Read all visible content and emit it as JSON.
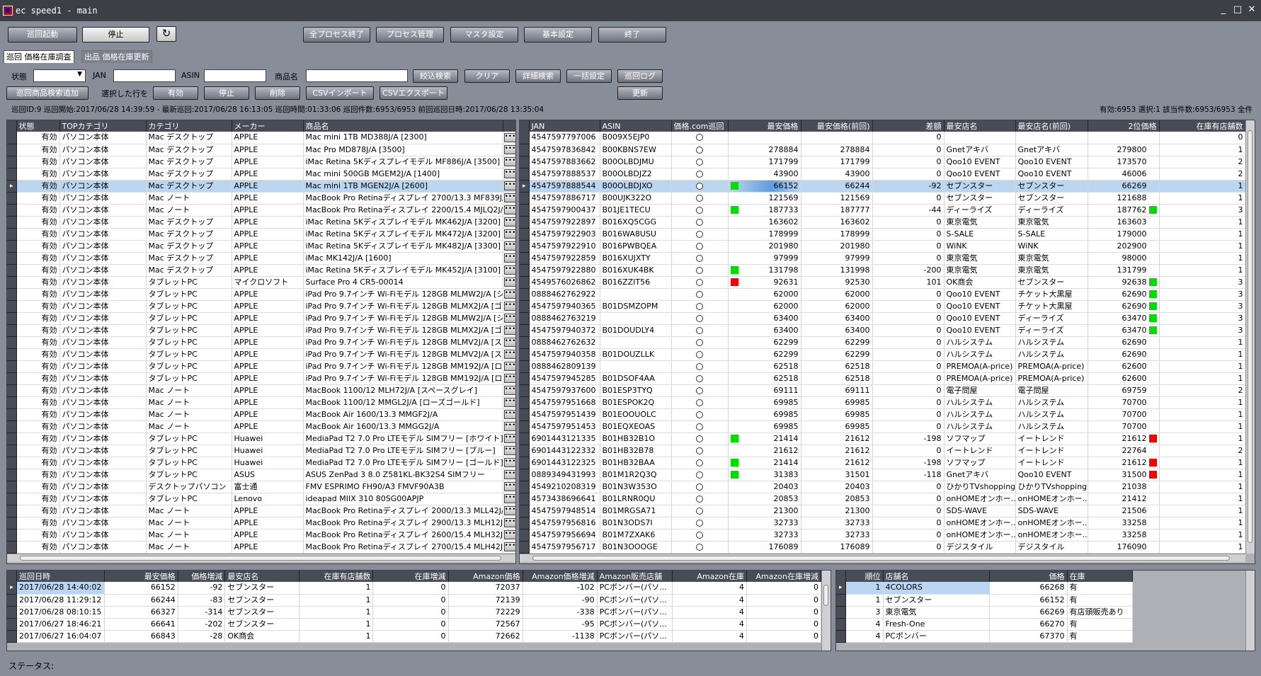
{
  "window": {
    "title": "ec speed1 - main",
    "min": "_",
    "max": "□",
    "close": "✕"
  },
  "toolbar": {
    "start": "巡回起動",
    "stop": "停止",
    "refresh": "↻",
    "all_stop": "全プロセス終了",
    "process": "プロセス管理",
    "master": "マスタ設定",
    "basic": "基本設定",
    "exit": "終了"
  },
  "tabs": [
    {
      "label": "巡回 価格在庫調査"
    },
    {
      "label": "出品 価格在庫更新"
    }
  ],
  "filter": {
    "state_label": "状態",
    "state_value": "",
    "jan_label": "JAN",
    "asin_label": "ASIN",
    "product_label": "商品名",
    "narrow": "絞込検索",
    "clear": "クリア",
    "detail": "詳細検索",
    "bulk": "一括設定",
    "log": "巡回ログ",
    "add": "巡回商品検索追加",
    "selected_rows": "選択した行を",
    "valid": "有効",
    "stop": "停止",
    "delete": "削除",
    "csv_import": "CSVインポート",
    "csv_export": "CSVエクスポート",
    "update": "更新"
  },
  "info": {
    "left": "巡回ID:9 巡回開始:2017/06/28 14:39:59 - 最新巡回:2017/06/28 16:13:05 巡回時間:01:33:06 巡回件数:6953/6953 前回巡回日時:2017/06/28 13:35:04",
    "right": "有効:6953 選択:1 該当件数:6953/6953 全件"
  },
  "left_table": {
    "headers": [
      "状態",
      "TOPカテゴリ",
      "カテゴリ",
      "メーカー",
      "商品名"
    ],
    "rows": [
      [
        "有効",
        "パソコン本体",
        "Mac デスクトップ",
        "APPLE",
        "Mac mini 1TB MD388J/A [2300]"
      ],
      [
        "有効",
        "パソコン本体",
        "Mac デスクトップ",
        "APPLE",
        "Mac Pro MD878J/A [3500]"
      ],
      [
        "有効",
        "パソコン本体",
        "Mac デスクトップ",
        "APPLE",
        "iMac Retina 5Kディスプレイモデル MF886J/A [3500]"
      ],
      [
        "有効",
        "パソコン本体",
        "Mac デスクトップ",
        "APPLE",
        "Mac mini 500GB MGEM2J/A [1400]"
      ],
      [
        "有効",
        "パソコン本体",
        "Mac デスクトップ",
        "APPLE",
        "Mac mini 1TB MGEN2J/A [2600]"
      ],
      [
        "有効",
        "パソコン本体",
        "Mac ノート",
        "APPLE",
        "MacBook Pro Retinaディスプレイ 2700/13.3 MF839J/A"
      ],
      [
        "有効",
        "パソコン本体",
        "Mac ノート",
        "APPLE",
        "MacBook Pro Retinaディスプレイ 2200/15.4 MJLQ2J/A"
      ],
      [
        "有効",
        "パソコン本体",
        "Mac デスクトップ",
        "APPLE",
        "iMac Retina 5Kディスプレイモデル MK462J/A [3200]"
      ],
      [
        "有効",
        "パソコン本体",
        "Mac デスクトップ",
        "APPLE",
        "iMac Retina 5Kディスプレイモデル MK472J/A [3200]"
      ],
      [
        "有効",
        "パソコン本体",
        "Mac デスクトップ",
        "APPLE",
        "iMac Retina 5Kディスプレイモデル MK482J/A [3300]"
      ],
      [
        "有効",
        "パソコン本体",
        "Mac デスクトップ",
        "APPLE",
        "iMac MK142J/A [1600]"
      ],
      [
        "有効",
        "パソコン本体",
        "Mac デスクトップ",
        "APPLE",
        "iMac Retina 5Kディスプレイモデル MK452J/A [3100]"
      ],
      [
        "有効",
        "パソコン本体",
        "タブレットPC",
        "マイクロソフト",
        "Surface Pro 4 CR5-00014"
      ],
      [
        "有効",
        "パソコン本体",
        "タブレットPC",
        "APPLE",
        "iPad Pro 9.7インチ Wi-Fiモデル 128GB MLMW2J/A [シ"
      ],
      [
        "有効",
        "パソコン本体",
        "タブレットPC",
        "APPLE",
        "iPad Pro 9.7インチ Wi-Fiモデル 128GB MLMX2J/A [ゴ"
      ],
      [
        "有効",
        "パソコン本体",
        "タブレットPC",
        "APPLE",
        "iPad Pro 9.7インチ Wi-Fiモデル 128GB MLMW2J/A [シ"
      ],
      [
        "有効",
        "パソコン本体",
        "タブレットPC",
        "APPLE",
        "iPad Pro 9.7インチ Wi-Fiモデル 128GB MLMX2J/A [ゴ"
      ],
      [
        "有効",
        "パソコン本体",
        "タブレットPC",
        "APPLE",
        "iPad Pro 9.7インチ Wi-Fiモデル 128GB MLMV2J/A [ス"
      ],
      [
        "有効",
        "パソコン本体",
        "タブレットPC",
        "APPLE",
        "iPad Pro 9.7インチ Wi-Fiモデル 128GB MLMV2J/A [ス"
      ],
      [
        "有効",
        "パソコン本体",
        "タブレットPC",
        "APPLE",
        "iPad Pro 9.7インチ Wi-Fiモデル 128GB MM192J/A [ロ"
      ],
      [
        "有効",
        "パソコン本体",
        "タブレットPC",
        "APPLE",
        "iPad Pro 9.7インチ Wi-Fiモデル 128GB MM192J/A [ロ"
      ],
      [
        "有効",
        "パソコン本体",
        "Mac ノート",
        "APPLE",
        "MacBook 1100/12 MLH72J/A [スペースグレイ]"
      ],
      [
        "有効",
        "パソコン本体",
        "Mac ノート",
        "APPLE",
        "MacBook 1100/12 MMGL2J/A [ローズゴールド]"
      ],
      [
        "有効",
        "パソコン本体",
        "Mac ノート",
        "APPLE",
        "MacBook Air 1600/13.3 MMGF2J/A"
      ],
      [
        "有効",
        "パソコン本体",
        "Mac ノート",
        "APPLE",
        "MacBook Air 1600/13.3 MMGG2J/A"
      ],
      [
        "有効",
        "パソコン本体",
        "タブレットPC",
        "Huawei",
        "MediaPad T2 7.0 Pro LTEモデル SIMフリー [ホワイト]"
      ],
      [
        "有効",
        "パソコン本体",
        "タブレットPC",
        "Huawei",
        "MediaPad T2 7.0 Pro LTEモデル SIMフリー [ブルー]"
      ],
      [
        "有効",
        "パソコン本体",
        "タブレットPC",
        "Huawei",
        "MediaPad T2 7.0 Pro LTEモデル SIMフリー [ゴールド]"
      ],
      [
        "有効",
        "パソコン本体",
        "タブレットPC",
        "ASUS",
        "ASUS ZenPad 3 8.0 Z581KL-BK32S4 SIMフリー"
      ],
      [
        "有効",
        "パソコン本体",
        "デスクトップパソコン",
        "富士通",
        "FMV ESPRIMO FH90/A3 FMVF90A3B"
      ],
      [
        "有効",
        "パソコン本体",
        "タブレットPC",
        "Lenovo",
        "ideapad MIIX 310 80SG00APJP"
      ],
      [
        "有効",
        "パソコン本体",
        "Mac ノート",
        "APPLE",
        "MacBook Pro Retinaディスプレイ 2000/13.3 MLL42J/A"
      ],
      [
        "有効",
        "パソコン本体",
        "Mac ノート",
        "APPLE",
        "MacBook Pro Retinaディスプレイ 2900/13.3 MLH12J/A"
      ],
      [
        "有効",
        "パソコン本体",
        "Mac ノート",
        "APPLE",
        "MacBook Pro Retinaディスプレイ 2600/15.4 MLH32J/A"
      ],
      [
        "有効",
        "パソコン本体",
        "Mac ノート",
        "APPLE",
        "MacBook Pro Retinaディスプレイ 2700/15.4 MLH42J/A"
      ]
    ]
  },
  "right_table": {
    "headers": [
      "JAN",
      "ASIN",
      "価格.com巡回",
      "最安価格",
      "最安価格(前回)",
      "差額",
      "最安店名",
      "最安店名(前回)",
      "2位価格",
      "在庫有店舗数"
    ],
    "rows": [
      [
        "4547597797006",
        "B009X5EJP0",
        "",
        "",
        "",
        "0",
        "",
        "",
        "",
        "",
        "0"
      ],
      [
        "4547597836842",
        "B00KBNS7EW",
        "",
        "278884",
        "278884",
        "0",
        "Gnetアキバ",
        "Gnetアキバ",
        "279800",
        "",
        "1"
      ],
      [
        "4547597883662",
        "B00OLBDJMU",
        "",
        "171799",
        "171799",
        "0",
        "Qoo10 EVENT",
        "Qoo10 EVENT",
        "173570",
        "",
        "2"
      ],
      [
        "4547597888537",
        "B00OLBDJZ2",
        "",
        "43900",
        "43900",
        "0",
        "Qoo10 EVENT",
        "Qoo10 EVENT",
        "46006",
        "",
        "2"
      ],
      [
        "4547597888544",
        "B00OLBDJXO",
        "green",
        "66152",
        "66244",
        "-92",
        "セブンスター",
        "セブンスター",
        "66269",
        "",
        "1"
      ],
      [
        "4547597886717",
        "B00UJK322O",
        "",
        "121569",
        "121569",
        "0",
        "セブンスター",
        "セブンスター",
        "121688",
        "",
        "1"
      ],
      [
        "4547597900437",
        "B01JE1TECU",
        "green",
        "187733",
        "187777",
        "-44",
        "ディーライズ",
        "ディーライズ",
        "187762",
        "green",
        "3"
      ],
      [
        "4547597922897",
        "B016XQ5CGG",
        "",
        "163602",
        "163602",
        "0",
        "東京電気",
        "東京電気",
        "163603",
        "",
        "1"
      ],
      [
        "4547597922903",
        "B016WA8USU",
        "",
        "178999",
        "178999",
        "0",
        "S-SALE",
        "S-SALE",
        "179000",
        "",
        "1"
      ],
      [
        "4547597922910",
        "B016PWBQEA",
        "",
        "201980",
        "201980",
        "0",
        "WiNK",
        "WiNK",
        "202900",
        "",
        "1"
      ],
      [
        "4547597922859",
        "B016XUJXTY",
        "",
        "97999",
        "97999",
        "0",
        "東京電気",
        "東京電気",
        "98000",
        "",
        "1"
      ],
      [
        "4547597922880",
        "B016XUK4BK",
        "green",
        "131798",
        "131998",
        "-200",
        "東京電気",
        "東京電気",
        "131799",
        "",
        "1"
      ],
      [
        "4549576026862",
        "B016ZZIT56",
        "red",
        "92631",
        "92530",
        "101",
        "OK商会",
        "セブンスター",
        "92638",
        "green",
        "3"
      ],
      [
        "0888462762922",
        "",
        "",
        "62000",
        "62000",
        "0",
        "Qoo10 EVENT",
        "チケット大黒屋",
        "62690",
        "green",
        "3"
      ],
      [
        "4547597940365",
        "B01DSMZOPM",
        "",
        "62000",
        "62000",
        "0",
        "Qoo10 EVENT",
        "チケット大黒屋",
        "62690",
        "green",
        "3"
      ],
      [
        "0888462763219",
        "",
        "",
        "63400",
        "63400",
        "0",
        "Qoo10 EVENT",
        "ディーライズ",
        "63470",
        "green",
        "3"
      ],
      [
        "4547597940372",
        "B01DOUDLY4",
        "",
        "63400",
        "63400",
        "0",
        "Qoo10 EVENT",
        "ディーライズ",
        "63470",
        "green",
        "3"
      ],
      [
        "0888462762632",
        "",
        "",
        "62299",
        "62299",
        "0",
        "ハルシステム",
        "ハルシステム",
        "62690",
        "",
        "1"
      ],
      [
        "4547597940358",
        "B01DOUZLLK",
        "",
        "62299",
        "62299",
        "0",
        "ハルシステム",
        "ハルシステム",
        "62690",
        "",
        "1"
      ],
      [
        "0888462809139",
        "",
        "",
        "62518",
        "62518",
        "0",
        "PREMOA(A-price)",
        "PREMOA(A-price)",
        "62600",
        "",
        "1"
      ],
      [
        "4547597945285",
        "B01DSOF4AA",
        "",
        "62518",
        "62518",
        "0",
        "PREMOA(A-price)",
        "PREMOA(A-price)",
        "62600",
        "",
        "1"
      ],
      [
        "4547597937600",
        "B01ESP3TYQ",
        "",
        "69111",
        "69111",
        "0",
        "電子問屋",
        "電子問屋",
        "69759",
        "",
        "2"
      ],
      [
        "4547597951668",
        "B01ESPOK2Q",
        "",
        "69985",
        "69985",
        "0",
        "ハルシステム",
        "ハルシステム",
        "70700",
        "",
        "1"
      ],
      [
        "4547597951439",
        "B01EOOUOLC",
        "",
        "69985",
        "69985",
        "0",
        "ハルシステム",
        "ハルシステム",
        "70700",
        "",
        "1"
      ],
      [
        "4547597951453",
        "B01EQXEOAS",
        "",
        "69985",
        "69985",
        "0",
        "ハルシステム",
        "ハルシステム",
        "70700",
        "",
        "1"
      ],
      [
        "6901443121335",
        "B01HB32B1O",
        "green",
        "21414",
        "21612",
        "-198",
        "ソフマップ",
        "イートレンド",
        "21612",
        "red",
        "1"
      ],
      [
        "6901443122332",
        "B01HB32B78",
        "",
        "21612",
        "21612",
        "0",
        "イートレンド",
        "イートレンド",
        "22764",
        "",
        "2"
      ],
      [
        "6901443122325",
        "B01HB32BAA",
        "green",
        "21414",
        "21612",
        "-198",
        "ソフマップ",
        "イートレンド",
        "21612",
        "red",
        "1"
      ],
      [
        "0889349431993",
        "B01M1R2Q3Q",
        "green",
        "31383",
        "31501",
        "-118",
        "Gnetアキバ",
        "Qoo10 EVENT",
        "31500",
        "red",
        "1"
      ],
      [
        "4549210208319",
        "B01N3W353O",
        "",
        "20403",
        "20403",
        "0",
        "ひかりTVshopping",
        "ひかりTVshopping",
        "21038",
        "",
        "1"
      ],
      [
        "4573438696641",
        "B01LRNR0QU",
        "",
        "20853",
        "20853",
        "0",
        "onHOMEオンホー...",
        "onHOMEオンホー...",
        "21412",
        "",
        "1"
      ],
      [
        "4547597948514",
        "B01MRGSA71",
        "",
        "21300",
        "21300",
        "0",
        "SDS-WAVE",
        "SDS-WAVE",
        "21506",
        "",
        "1"
      ],
      [
        "4547597956816",
        "B01N3ODS7I",
        "",
        "32733",
        "32733",
        "0",
        "onHOMEオンホー...",
        "onHOMEオンホー...",
        "33258",
        "",
        "1"
      ],
      [
        "4547597956694",
        "B01M7ZXAK6",
        "",
        "32733",
        "32733",
        "0",
        "onHOMEオンホー...",
        "onHOMEオンホー...",
        "33258",
        "",
        "1"
      ],
      [
        "4547597956717",
        "B01N3OOOGE",
        "",
        "176089",
        "176089",
        "0",
        "デジスタイル",
        "デジスタイル",
        "176090",
        "",
        "1"
      ]
    ]
  },
  "history_table": {
    "headers": [
      "巡回日時",
      "最安価格",
      "価格増減",
      "最安店名",
      "在庫有店舗数",
      "在庫増減",
      "Amazon価格",
      "Amazon価格増減",
      "Amazon販売店舗",
      "Amazon在庫",
      "Amazon在庫増減"
    ],
    "rows": [
      [
        "2017/06/28 14:40:02",
        "66152",
        "-92",
        "セブンスター",
        "1",
        "0",
        "72037",
        "-102",
        "PCボンバー(パソ...",
        "4",
        "0"
      ],
      [
        "2017/06/28 11:29:12",
        "66244",
        "-83",
        "セブンスター",
        "1",
        "0",
        "72139",
        "-90",
        "PCボンバー(パソ...",
        "4",
        "0"
      ],
      [
        "2017/06/28 08:10:15",
        "66327",
        "-314",
        "セブンスター",
        "1",
        "0",
        "72229",
        "-338",
        "PCボンバー(パソ...",
        "4",
        "0"
      ],
      [
        "2017/06/27 18:46:21",
        "66641",
        "-202",
        "セブンスター",
        "1",
        "0",
        "72567",
        "-95",
        "PCボンバー(パソ...",
        "4",
        "0"
      ],
      [
        "2017/06/27 16:04:07",
        "66843",
        "-28",
        "OK商会",
        "1",
        "0",
        "72662",
        "-1138",
        "PCボンバー(パソ...",
        "4",
        "0"
      ]
    ]
  },
  "rank_table": {
    "headers": [
      "順位",
      "店舗名",
      "価格",
      "在庫"
    ],
    "rows": [
      [
        "1",
        "4COLORS",
        "66268",
        "有"
      ],
      [
        "1",
        "セブンスター",
        "66152",
        "有"
      ],
      [
        "3",
        "東京電気",
        "66269",
        "有店頭販売あり"
      ],
      [
        "4",
        "Fresh-One",
        "66270",
        "有"
      ],
      [
        "4",
        "PCボンバー",
        "67370",
        "有"
      ]
    ]
  },
  "status": {
    "label": "ステータス:"
  },
  "colors": {
    "accent_selected": "#bad6f1",
    "indicator_green": "#00e000",
    "indicator_red": "#ff0000",
    "header_bg": "#474c56"
  }
}
